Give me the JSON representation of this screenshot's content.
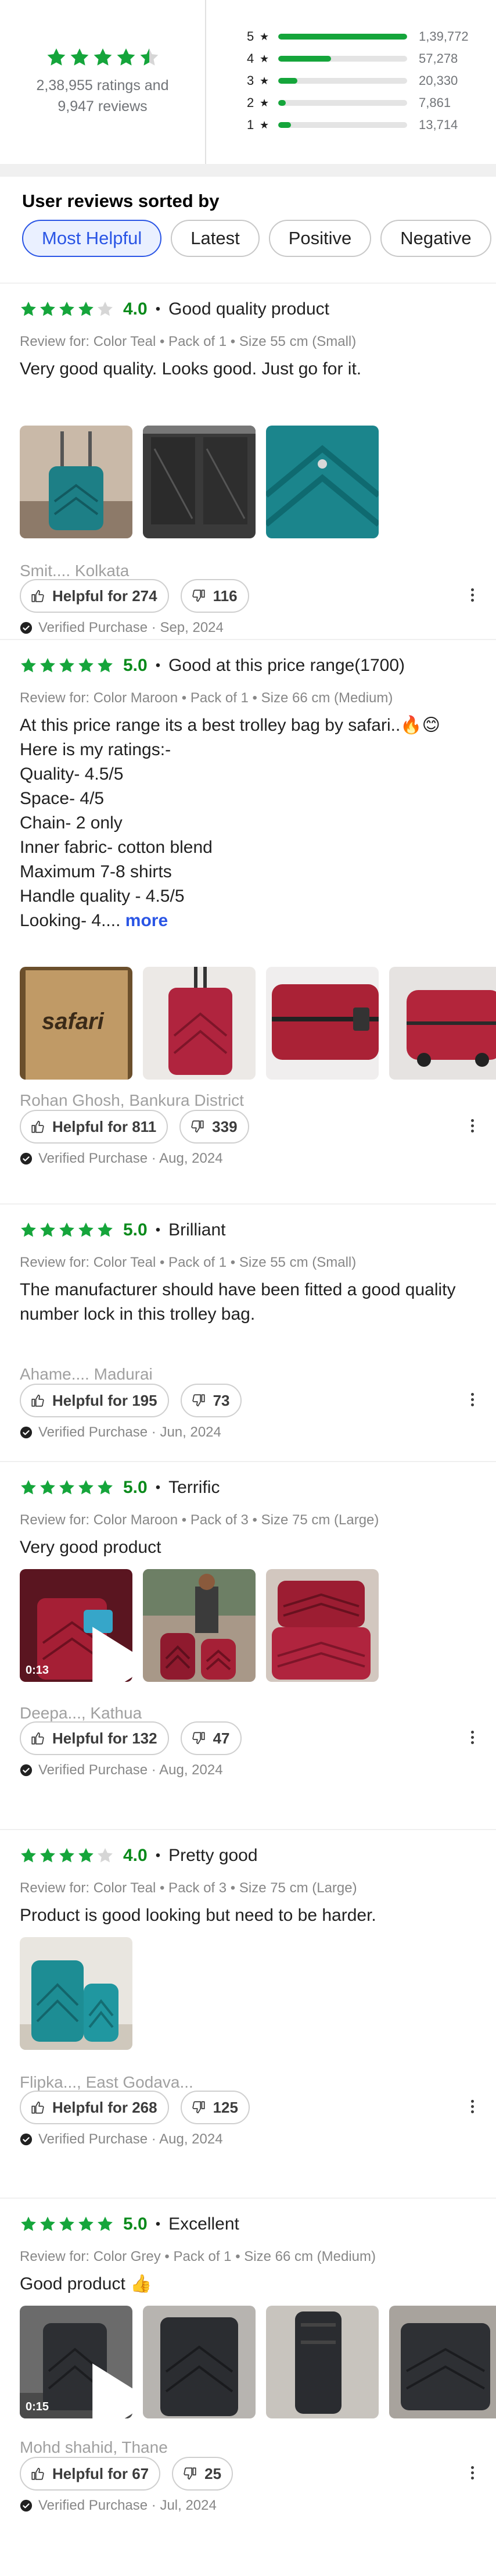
{
  "summary": {
    "stars_value": 4.5,
    "ratings_text": "2,38,955 ratings and",
    "reviews_text": "9,947 reviews",
    "breakdown": [
      {
        "label": "5",
        "star": "★",
        "count": "1,39,772",
        "fraction": 0.585
      },
      {
        "label": "4",
        "star": "★",
        "count": "57,278",
        "fraction": 0.24
      },
      {
        "label": "3",
        "star": "★",
        "count": "20,330",
        "fraction": 0.085
      },
      {
        "label": "2",
        "star": "★",
        "count": "7,861",
        "fraction": 0.033
      },
      {
        "label": "1",
        "star": "★",
        "count": "13,714",
        "fraction": 0.057
      }
    ]
  },
  "sort": {
    "title": "User reviews sorted by",
    "chips": [
      "Most Helpful",
      "Latest",
      "Positive",
      "Negative"
    ],
    "active": 0
  },
  "colors": {
    "green_star": "#15a53b",
    "rating_text": "#0a8a1b",
    "accent": "#2a55e5"
  },
  "reviews": [
    {
      "stars": 4,
      "rating": "4.0",
      "dot": "•",
      "title": "Good quality product",
      "meta": "Review for: Color Teal • Pack of 1 • Size 55 cm (Small)",
      "body": [
        "Very good quality. Looks good. Just go for it."
      ],
      "images": [
        "photo-teal-trolley",
        "photo-open-case-interior",
        "photo-teal-shell"
      ],
      "author": "Smit.... Kolkata",
      "helpful": "Helpful for 274",
      "dislikes": "116",
      "verified": "Verified Purchase · Sep, 2024"
    },
    {
      "stars": 5,
      "rating": "5.0",
      "dot": "•",
      "title": "Good at this price range(1700)",
      "meta": "Review for: Color Maroon • Pack of 1 • Size 66 cm (Medium)",
      "body": [
        "At this price range its a best trolley bag by safari..🔥😊",
        "Here is my ratings:-",
        "Quality- 4.5/5",
        "Space- 4/5",
        "Chain- 2 only",
        "Inner fabric- cotton blend",
        "Maximum 7-8 shirts",
        "Handle quality - 4.5/5",
        "Looking- 4...."
      ],
      "more": "more",
      "images": [
        "photo-safari-box",
        "photo-maroon-trolley",
        "photo-maroon-closeup",
        "photo-maroon-side"
      ],
      "box_brand": "safari",
      "author": "Rohan Ghosh, Bankura District",
      "helpful": "Helpful for 811",
      "dislikes": "339",
      "verified": "Verified Purchase · Aug, 2024"
    },
    {
      "stars": 5,
      "rating": "5.0",
      "dot": "•",
      "title": "Brilliant",
      "meta": "Review for: Color Teal • Pack of 1 • Size 55 cm (Small)",
      "body": [
        "The manufacturer should have been fitted a good quality",
        "number lock in this trolley bag."
      ],
      "images": [],
      "author": "Ahame.... Madurai",
      "helpful": "Helpful for 195",
      "dislikes": "73",
      "verified": "Verified Purchase · Jun, 2024"
    },
    {
      "stars": 5,
      "rating": "5.0",
      "dot": "•",
      "title": "Terrific",
      "meta": "Review for: Color Maroon • Pack of 3 • Size 75 cm (Large)",
      "body": [
        "Very good product"
      ],
      "images": [
        "video-maroon",
        "photo-maroon-person",
        "photo-maroon-stack"
      ],
      "duration": "0:13",
      "author": "Deepa..., Kathua",
      "helpful": "Helpful for 132",
      "dislikes": "47",
      "verified": "Verified Purchase · Aug, 2024"
    },
    {
      "stars": 4,
      "rating": "4.0",
      "dot": "•",
      "title": "Pretty good",
      "meta": "Review for: Color Teal • Pack of 3 • Size 75 cm (Large)",
      "body": [
        "Product is good looking but need to be harder."
      ],
      "images": [
        "photo-teal-set"
      ],
      "author": "Flipka..., East Godava...",
      "helpful": "Helpful for 268",
      "dislikes": "125",
      "verified": "Verified Purchase · Aug, 2024"
    },
    {
      "stars": 5,
      "rating": "5.0",
      "dot": "•",
      "title": "Excellent",
      "meta": "Review for: Color Grey • Pack of 1 • Size 66 cm (Medium)",
      "body": [
        "Good product 👍"
      ],
      "images": [
        "video-grey",
        "photo-grey-front",
        "photo-grey-side",
        "photo-grey-back"
      ],
      "duration": "0:15",
      "author": "Mohd shahid, Thane",
      "helpful": "Helpful for 67",
      "dislikes": "25",
      "verified": "Verified Purchase · Jul, 2024"
    }
  ]
}
